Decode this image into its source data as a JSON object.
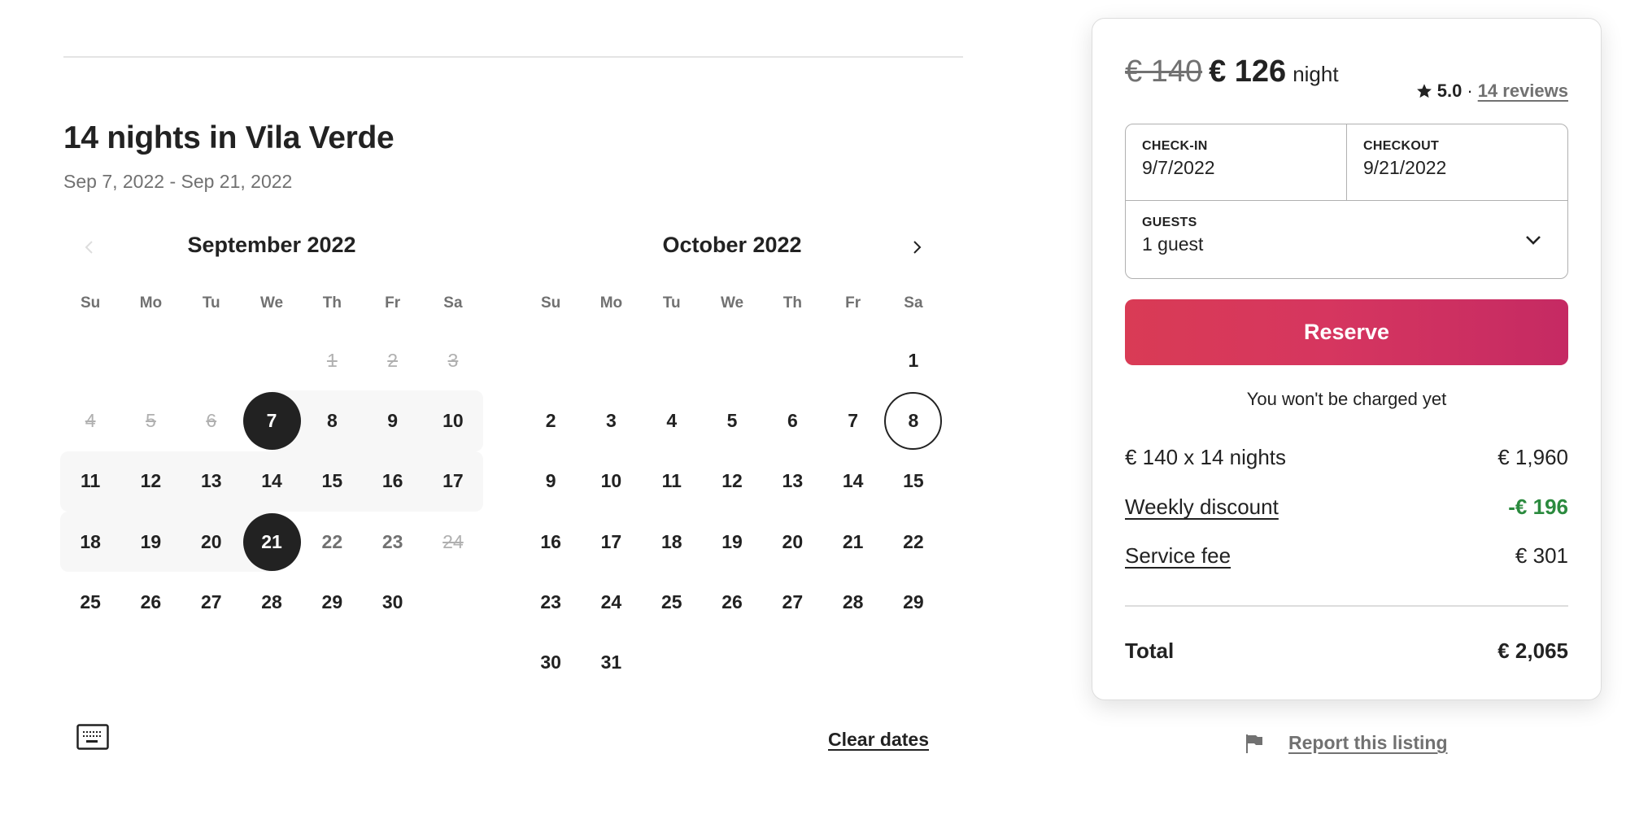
{
  "header": {
    "title": "14 nights in Vila Verde",
    "date_range": "Sep 7, 2022 - Sep 21, 2022"
  },
  "calendar": {
    "weekdays": [
      "Su",
      "Mo",
      "Tu",
      "We",
      "Th",
      "Fr",
      "Sa"
    ],
    "months": [
      {
        "title": "September 2022",
        "leading_blanks": 4,
        "days": [
          {
            "n": "1",
            "state": "blocked"
          },
          {
            "n": "2",
            "state": "blocked"
          },
          {
            "n": "3",
            "state": "blocked"
          },
          {
            "n": "4",
            "state": "blocked"
          },
          {
            "n": "5",
            "state": "blocked"
          },
          {
            "n": "6",
            "state": "blocked"
          },
          {
            "n": "7",
            "state": "selected-start"
          },
          {
            "n": "8",
            "state": "in-range"
          },
          {
            "n": "9",
            "state": "in-range"
          },
          {
            "n": "10",
            "state": "in-range"
          },
          {
            "n": "11",
            "state": "in-range"
          },
          {
            "n": "12",
            "state": "in-range"
          },
          {
            "n": "13",
            "state": "in-range"
          },
          {
            "n": "14",
            "state": "in-range"
          },
          {
            "n": "15",
            "state": "in-range"
          },
          {
            "n": "16",
            "state": "in-range"
          },
          {
            "n": "17",
            "state": "in-range"
          },
          {
            "n": "18",
            "state": "in-range"
          },
          {
            "n": "19",
            "state": "in-range"
          },
          {
            "n": "20",
            "state": "in-range"
          },
          {
            "n": "21",
            "state": "selected-end"
          },
          {
            "n": "22",
            "state": "muted"
          },
          {
            "n": "23",
            "state": "muted"
          },
          {
            "n": "24",
            "state": "blocked"
          },
          {
            "n": "25",
            "state": "available"
          },
          {
            "n": "26",
            "state": "available"
          },
          {
            "n": "27",
            "state": "available"
          },
          {
            "n": "28",
            "state": "available"
          },
          {
            "n": "29",
            "state": "available"
          },
          {
            "n": "30",
            "state": "available"
          }
        ]
      },
      {
        "title": "October 2022",
        "leading_blanks": 6,
        "days": [
          {
            "n": "1",
            "state": "available"
          },
          {
            "n": "2",
            "state": "available"
          },
          {
            "n": "3",
            "state": "available"
          },
          {
            "n": "4",
            "state": "available"
          },
          {
            "n": "5",
            "state": "available"
          },
          {
            "n": "6",
            "state": "available"
          },
          {
            "n": "7",
            "state": "available"
          },
          {
            "n": "8",
            "state": "outlined"
          },
          {
            "n": "9",
            "state": "available"
          },
          {
            "n": "10",
            "state": "available"
          },
          {
            "n": "11",
            "state": "available"
          },
          {
            "n": "12",
            "state": "available"
          },
          {
            "n": "13",
            "state": "available"
          },
          {
            "n": "14",
            "state": "available"
          },
          {
            "n": "15",
            "state": "available"
          },
          {
            "n": "16",
            "state": "available"
          },
          {
            "n": "17",
            "state": "available"
          },
          {
            "n": "18",
            "state": "available"
          },
          {
            "n": "19",
            "state": "available"
          },
          {
            "n": "20",
            "state": "available"
          },
          {
            "n": "21",
            "state": "available"
          },
          {
            "n": "22",
            "state": "available"
          },
          {
            "n": "23",
            "state": "available"
          },
          {
            "n": "24",
            "state": "available"
          },
          {
            "n": "25",
            "state": "available"
          },
          {
            "n": "26",
            "state": "available"
          },
          {
            "n": "27",
            "state": "available"
          },
          {
            "n": "28",
            "state": "available"
          },
          {
            "n": "29",
            "state": "available"
          },
          {
            "n": "30",
            "state": "available"
          },
          {
            "n": "31",
            "state": "available"
          }
        ]
      }
    ],
    "prev_icon": "chevron-left-icon",
    "next_icon": "chevron-right-icon",
    "keyboard_icon": "keyboard-icon",
    "clear_dates_label": "Clear dates"
  },
  "booking": {
    "original_price": "€ 140",
    "price": "€ 126",
    "per": "night",
    "rating": "5.0",
    "separator": "·",
    "reviews_label": "14 reviews",
    "checkin_label": "CHECK-IN",
    "checkin_value": "9/7/2022",
    "checkout_label": "CHECKOUT",
    "checkout_value": "9/21/2022",
    "guests_label": "GUESTS",
    "guests_value": "1 guest",
    "reserve_label": "Reserve",
    "not_charged": "You won't be charged yet",
    "line_items": [
      {
        "label": "€ 140 x 14 nights",
        "value": "€ 1,960"
      },
      {
        "label": "Weekly discount",
        "value": "-€ 196"
      },
      {
        "label": "Service fee",
        "value": "€ 301"
      }
    ],
    "total_label": "Total",
    "total_value": "€ 2,065",
    "colors": {
      "reserve_start": "#d93b55",
      "reserve_end": "#c52a63",
      "discount": "#2b8a3e"
    }
  },
  "report": {
    "label": "Report this listing",
    "icon": "flag-icon"
  }
}
